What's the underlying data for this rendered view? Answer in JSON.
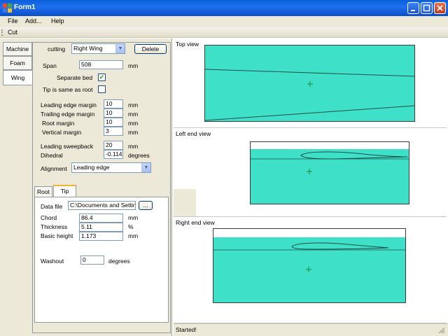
{
  "window": {
    "title": "Form1",
    "accent": "#0a5fd8"
  },
  "menu": [
    "File",
    "Add...",
    "Help"
  ],
  "toolbar": {
    "cut_label": "Cut"
  },
  "side_tabs": [
    "Machine",
    "Foam",
    "Wing"
  ],
  "wing": {
    "cutting_label": "cutting",
    "cutting_value": "Right Wing",
    "delete_label": "Delete",
    "span_label": "Span",
    "span_value": "508",
    "span_unit": "mm",
    "separate_bed_label": "Separate bed",
    "separate_bed_checked": true,
    "tip_same_label": "Tip is same as root",
    "tip_same_checked": false,
    "margins": [
      {
        "label": "Leading edge margin",
        "value": "10",
        "unit": "mm"
      },
      {
        "label": "Trailing edge margin",
        "value": "10",
        "unit": "mm"
      },
      {
        "label": "Root margin",
        "value": "10",
        "unit": "mm"
      },
      {
        "label": "Vertical margin",
        "value": "3",
        "unit": "mm"
      }
    ],
    "sweepback_label": "Leading sweepback",
    "sweepback_value": "20",
    "sweepback_unit": "mm",
    "dihedral_label": "Dihedral",
    "dihedral_value": "-0.114",
    "dihedral_unit": "degrees",
    "alignment_label": "Alignment",
    "alignment_value": "Leading edge"
  },
  "section_tabs": [
    "Root",
    "Tip"
  ],
  "tip": {
    "datafile_label": "Data file",
    "datafile_value": "C:\\Documents and Settin",
    "browse_label": "...",
    "chord_label": "Chord",
    "chord_value": "86.4",
    "chord_unit": "mm",
    "thickness_label": "Thickness",
    "thickness_value": "5.11",
    "thickness_unit": "%",
    "basic_height_label": "Basic height",
    "basic_height_value": "1.173",
    "basic_height_unit": "mm",
    "washout_label": "Washout",
    "washout_value": "0",
    "washout_unit": "degrees"
  },
  "views": {
    "top": "Top view",
    "left": "Left end view",
    "right": "Right end view"
  },
  "status": "Started!",
  "colors": {
    "foam": "#3ee0c8",
    "crosshair": "#1a8a3a"
  }
}
